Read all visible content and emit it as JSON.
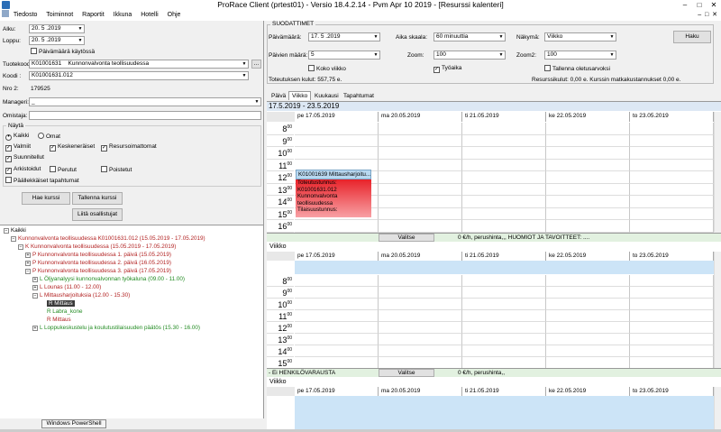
{
  "window": {
    "title": "ProRace Client (prtest01)  - Versio 18.4.2.14 - Pvm Apr 10 2019 - [Resurssi kalenteri]",
    "min": "–",
    "max": "□",
    "close": "✕"
  },
  "menu": [
    "Tiedosto",
    "Toiminnot",
    "Raportit",
    "Ikkuna",
    "Hotelli",
    "Ohje"
  ],
  "left": {
    "alku_label": "Alku:",
    "alku": "20. 5 .2019",
    "loppu_label": "Loppu:",
    "loppu": "20. 5 .2019",
    "paivamaara_kaytossa": "Päivämäärä käytössä",
    "tuotekoodi_label": "Tuotekoodi:",
    "tuotekoodi": "K01001631",
    "tuotekoodi_name": "Kunnonvalvonta teollisuudessa",
    "dots": "...",
    "koodi_label": "Koodi :",
    "koodi": "K01001631.012",
    "nro2_label": "Nro 2:",
    "nro2": "179525",
    "manageri_label": "Manageri:",
    "manageri": "_",
    "omistaja_label": "Omistaja:",
    "nayta_label": "Näytä",
    "kaikki": "Kaikki",
    "omat": "Omat",
    "valmiit": "Valmiit",
    "keskeneraiset": "Keskeneräiset",
    "resursoimattomat": "Resursoimattomat",
    "suunnitellut": "Suunnitellut",
    "arkistoidut": "Arkistoidut",
    "perutut": "Perutut",
    "poistetut": "Poistetut",
    "paallekkaiset": "Päällekkäiset tapahtumat",
    "hae_kurssi": "Hae kurssi",
    "tallenna_kurssi": "Tallenna kurssi",
    "liita": "Liitä osallistujat"
  },
  "tree": [
    {
      "t": "Kaikki",
      "c": "",
      "i": 0,
      "e": "⊟"
    },
    {
      "t": "Kunnonvalvonta teollisuudessa  K01001631.012 (15.05.2019 - 17.05.2019)",
      "c": "red",
      "i": 1,
      "e": "⊟"
    },
    {
      "t": "K  Kunnonvalvonta teollisuudessa (15.05.2019 - 17.05.2019)",
      "c": "red",
      "i": 2,
      "e": "⊟"
    },
    {
      "t": "P  Kunnonvalvonta teollisuudessa 1. päivä (15.05.2019)",
      "c": "red",
      "i": 3,
      "e": "⊞"
    },
    {
      "t": "P  Kunnonvalvonta teollisuudessa 2. päivä (16.05.2019)",
      "c": "red",
      "i": 3,
      "e": "⊞"
    },
    {
      "t": "P  Kunnonvalvonta teollisuudessa 3. päivä (17.05.2019)",
      "c": "red",
      "i": 3,
      "e": "⊟"
    },
    {
      "t": "L  Öljyanalyysi kunnonvalvonnan työkaluna (09.00 - 11.00)",
      "c": "green",
      "i": 4,
      "e": "⊞"
    },
    {
      "t": "L  Lounas (11.00 - 12.00)",
      "c": "red",
      "i": 4,
      "e": "⊞"
    },
    {
      "t": "L  Mittausharjoituksia (12.00 - 15.30)",
      "c": "red",
      "i": 4,
      "e": "⊟"
    },
    {
      "t": "R  Mittaus",
      "c": "sel",
      "i": 5,
      "e": ""
    },
    {
      "t": "R  Labra_kone",
      "c": "green",
      "i": 5,
      "e": ""
    },
    {
      "t": "R  Mittaus",
      "c": "red",
      "i": 5,
      "e": ""
    },
    {
      "t": "L  Loppukeskustelu ja koulutustilaisuuden päätös (15.30 - 16.00)",
      "c": "green",
      "i": 4,
      "e": "⊞"
    }
  ],
  "tooltip": "Windows PowerShell",
  "filters": {
    "title": "SUODATTIMET",
    "paivamaara_label": "Päivämäärä:",
    "paivamaara": "17. 5 .2019",
    "aikaskaala_label": "Aika skaala:",
    "aikaskaala": "60 minuuttia",
    "nakyma_label": "Näkymä:",
    "nakyma": "Viikko",
    "haku": "Haku",
    "paivien_maara_label": "Päivien määrä:",
    "paivien_maara": "5",
    "zoom_label": "Zoom:",
    "zoom": "100",
    "zoom2_label": "Zoom2:",
    "zoom2": "100",
    "koko_viikko": "Koko viikko",
    "tyoaika": "Työaika",
    "tallenna_oletus": "Tallenna oletusarvoksi",
    "toteutuksen_kulut": "Toteutuksen kulut: 557,75 e.",
    "resurssikulut": "Resurssikulut: 0,00 e. Kurssin matkakustannukset 0,00 e."
  },
  "tabs": [
    "Päivä",
    "Viikko",
    "Kuukausi",
    "Tapahtumat"
  ],
  "cal1": {
    "range": "17.5.2019 - 23.5.2019",
    "days": [
      "pe 17.05.2019",
      "ma 20.05.2019",
      "ti 21.05.2019",
      "ke 22.05.2019",
      "to 23.05.2019"
    ],
    "hours": [
      "8",
      "9",
      "10",
      "11",
      "12",
      "13",
      "14",
      "15",
      "16"
    ],
    "min": "00",
    "event_head": "K01001639  Mittausharjoitu...",
    "event_body": [
      "Toteutustunnus:",
      "K01001631.012",
      "Kunnonvalvonta",
      "teollisuudessa",
      "Tilaisuustunnus:"
    ]
  },
  "sec2": {
    "valitse": "Valitse",
    "info": "0 €/h, perushinta,,,  HUOMIOT JA TAVOITTEET: ....   ",
    "view": "Viikko",
    "days": [
      "pe 17.05.2019",
      "ma 20.05.2019",
      "ti 21.05.2019",
      "ke 22.05.2019",
      "to 23.05.2019"
    ],
    "hours": [
      "8",
      "9",
      "10",
      "11",
      "12",
      "13",
      "14",
      "15"
    ]
  },
  "sec3": {
    "title": "- Ei HENKILÖVARAUSTA",
    "valitse": "Valitse",
    "info": "0 €/h, perushinta,,",
    "view": "Viikko",
    "days": [
      "pe 17.05.2019",
      "ma 20.05.2019",
      "ti 21.05.2019",
      "ke 22.05.2019",
      "to 23.05.2019"
    ]
  },
  "colors": {
    "accent": "#cce4f7",
    "event_red": "#e8232a",
    "event_blue": "#b8d8f0",
    "green_bar": "#e2f1e0"
  }
}
